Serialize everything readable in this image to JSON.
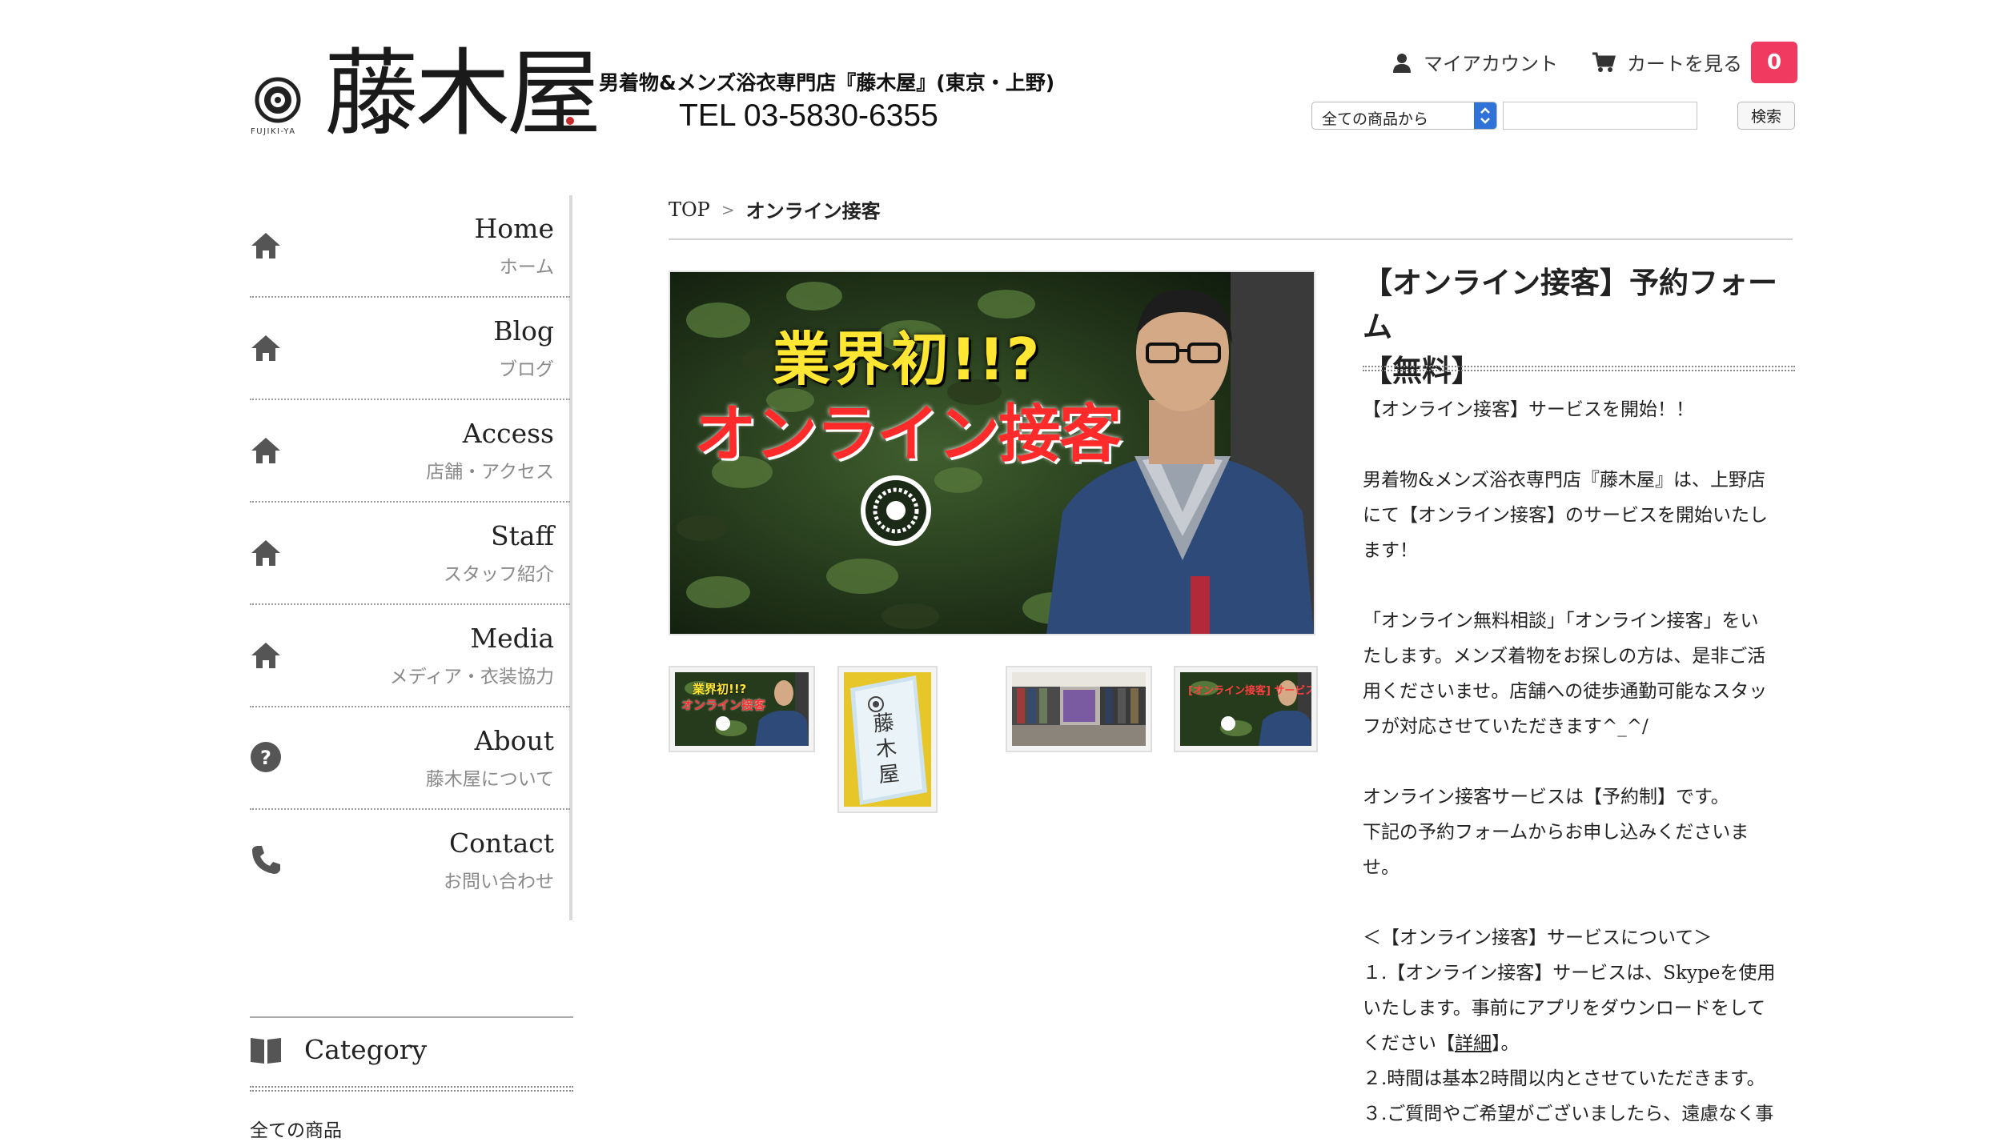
{
  "header": {
    "logo_text": "藤木屋",
    "logo_sub": "FUJIKI-YA",
    "tagline": "男着物&メンズ浴衣専門店『藤木屋』(東京・上野)",
    "tel": "TEL 03-5830-6355",
    "account_label": "マイアカウント",
    "cart_label": "カートを見る",
    "cart_count": "0",
    "search_category": "全ての商品から",
    "search_value": "",
    "search_button": "検索",
    "accent_color": "#f03a5f"
  },
  "sidebar": {
    "items": [
      {
        "en": "Home",
        "jp": "ホーム",
        "icon": "home-icon"
      },
      {
        "en": "Blog",
        "jp": "ブログ",
        "icon": "home-icon"
      },
      {
        "en": "Access",
        "jp": "店舗・アクセス",
        "icon": "home-icon"
      },
      {
        "en": "Staff",
        "jp": "スタッフ紹介",
        "icon": "home-icon"
      },
      {
        "en": "Media",
        "jp": "メディア・衣装協力",
        "icon": "home-icon"
      },
      {
        "en": "About",
        "jp": "藤木屋について",
        "icon": "question-icon"
      },
      {
        "en": "Contact",
        "jp": "お問い合わせ",
        "icon": "phone-icon"
      }
    ],
    "category_title": "Category",
    "category_first": "全ての商品"
  },
  "breadcrumb": {
    "top": "TOP",
    "separator": ">",
    "current": "オンライン接客"
  },
  "product": {
    "banner_line1": "業界初!!?",
    "banner_line2": "オンライン接客",
    "thumb1_line1": "業界初!!?",
    "thumb1_line2": "オンライン接客",
    "thumb2_text": "藤木屋",
    "thumb4_text": "[オンライン接客] サービス開始",
    "title_line1": "【オンライン接客】予約フォーム",
    "title_line2": "【無料】",
    "desc": {
      "p1": "【オンライン接客】サービスを開始！！",
      "p2_l1": "男着物&メンズ浴衣専門店『藤木屋』は、上野店",
      "p2_l2": "にて【オンライン接客】のサービスを開始いたし",
      "p2_l3": "ます！",
      "p3_l1": "「オンライン無料相談」「オンライン接客」をい",
      "p3_l2": "たします。メンズ着物をお探しの方は、是非ご活",
      "p3_l3": "用くださいませ。店舗への徒歩通勤可能なスタッ",
      "p3_l4": "フが対応させていただきます^_^/",
      "p4_l1": "オンライン接客サービスは【予約制】です。",
      "p4_l2": "下記の予約フォームからお申し込みくださいま",
      "p4_l3": "せ。",
      "p5_head": "＜【オンライン接客】サービスについて＞",
      "p5_l1": "１.【オンライン接客】サービスは、Skypeを使用",
      "p5_l2": "いたします。事前にアプリをダウンロードをして",
      "p5_l3a": "ください【",
      "p5_link": "詳細",
      "p5_l3b": "】。",
      "p5_l4": "２.時間は基本2時間以内とさせていただきます。",
      "p5_l5": "３.ご質問やご希望がございましたら、遠慮なく事"
    }
  }
}
